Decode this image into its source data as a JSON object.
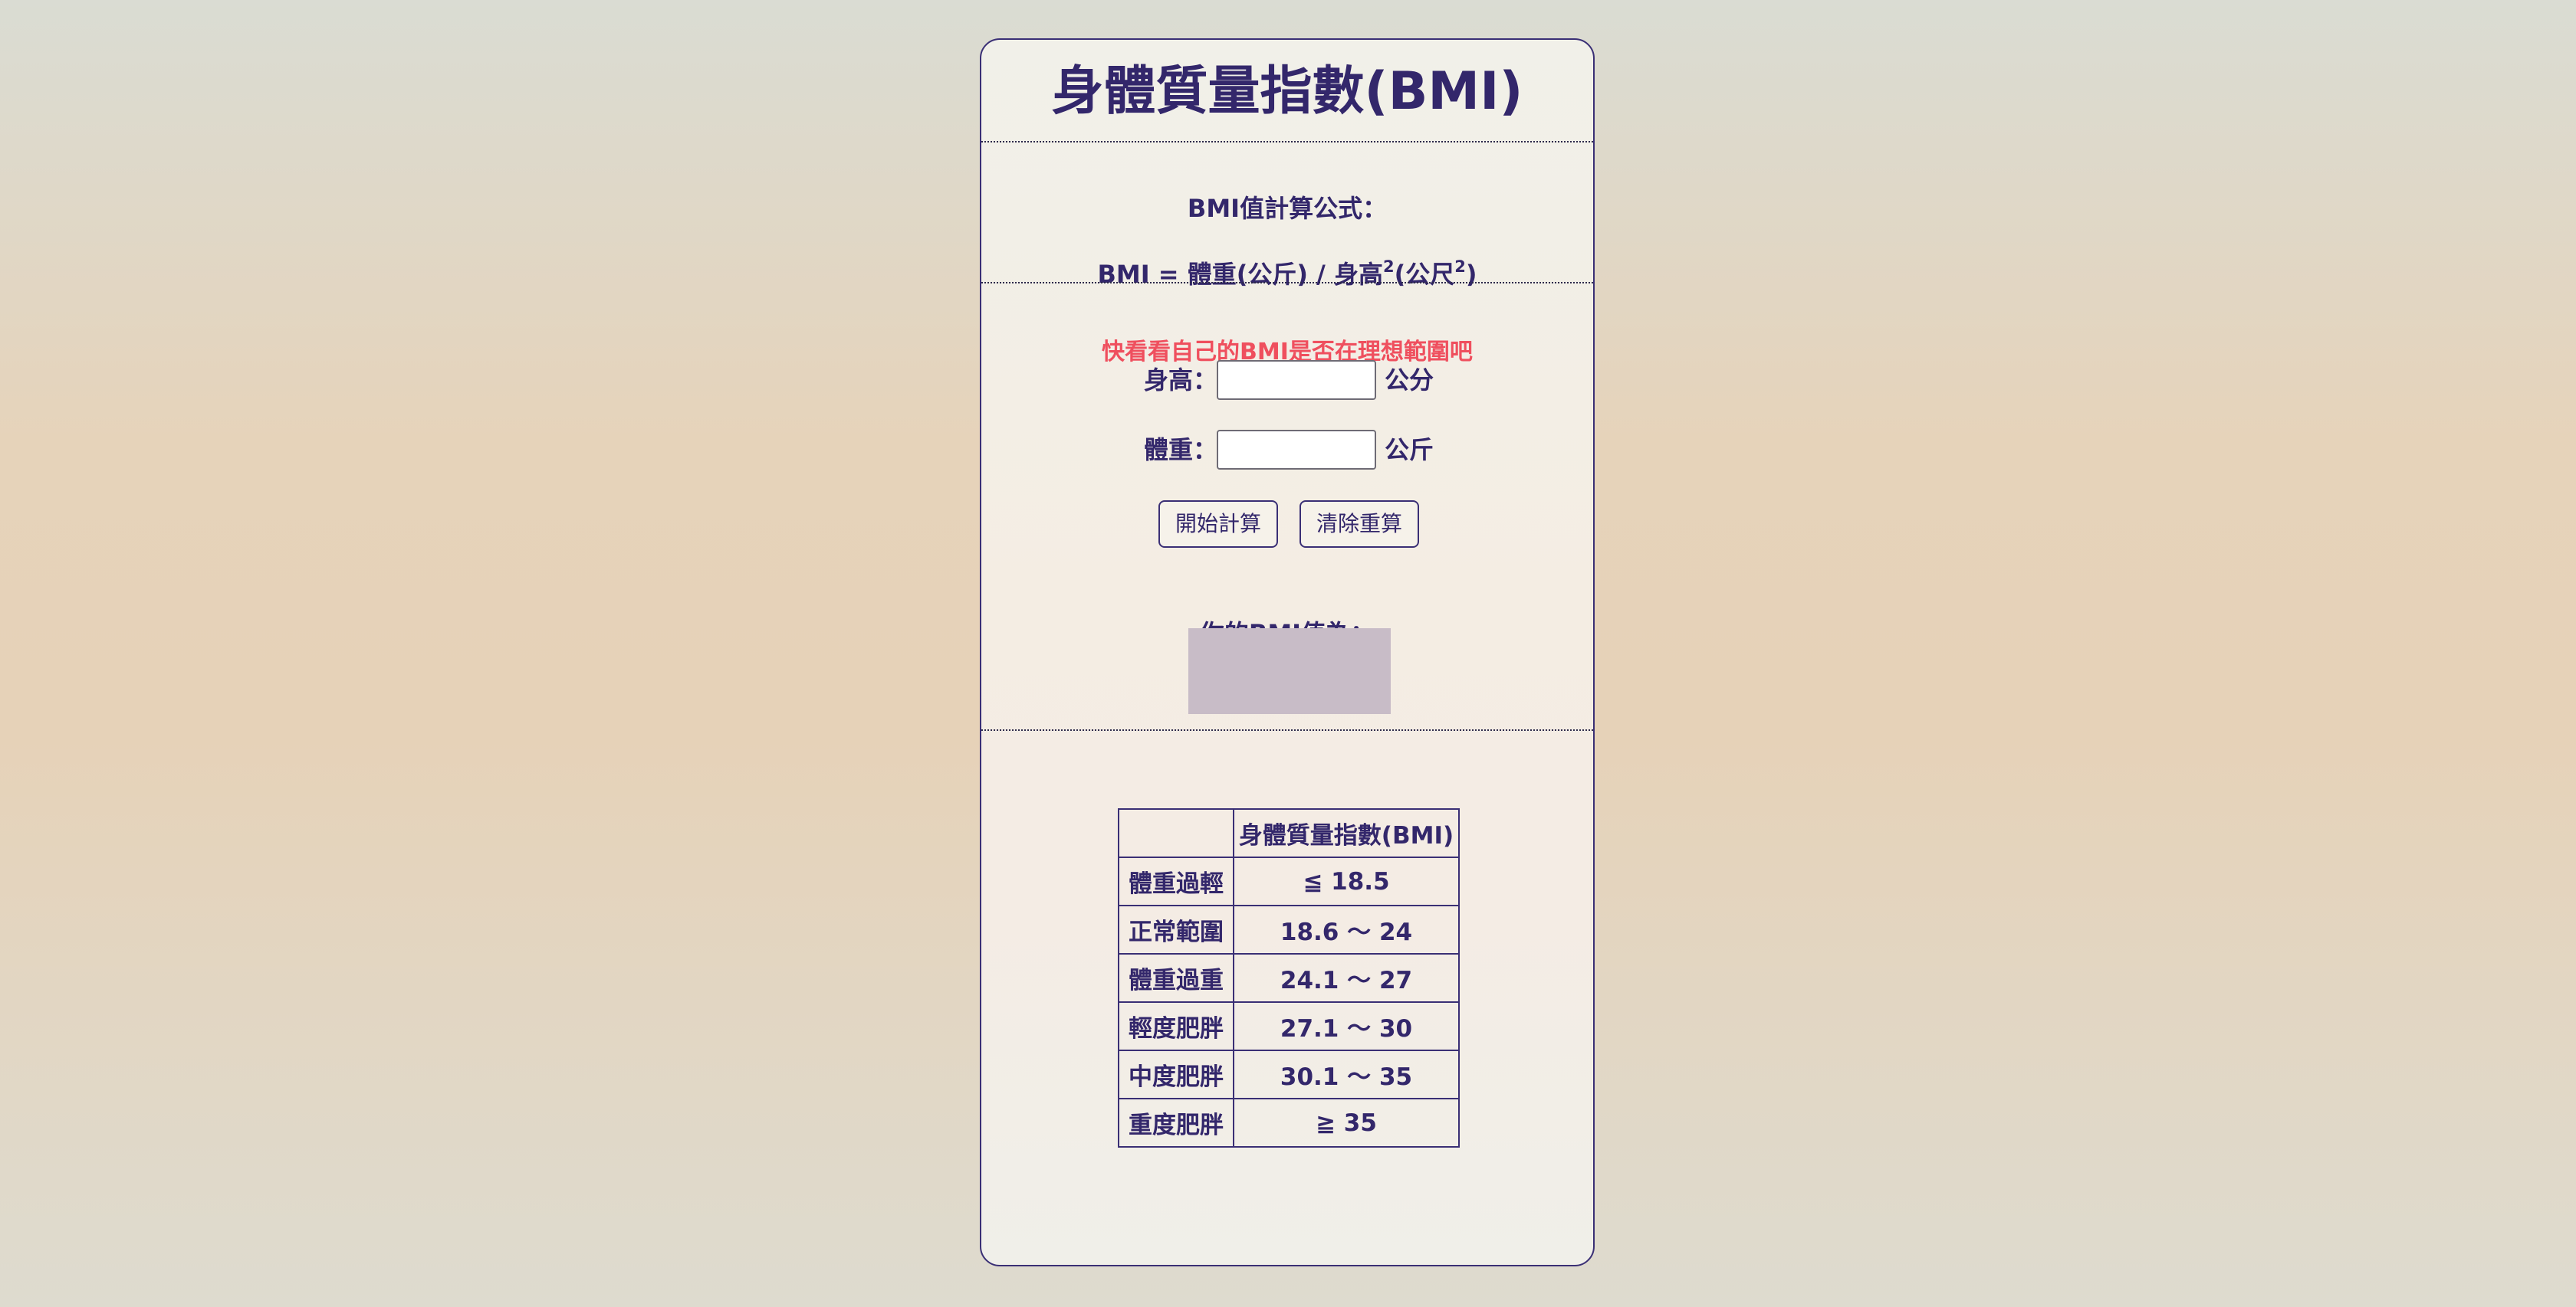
{
  "header": {
    "title": "身體質量指數(BMI)"
  },
  "formula": {
    "label": "BMI值計算公式：",
    "prefix": "BMI = 體重(公斤) / 身高",
    "exp1": "2",
    "middle": "(公尺",
    "exp2": "2",
    "suffix": ")"
  },
  "form": {
    "hint": "快看看自己的BMI是否在理想範圍吧",
    "height_label": "身高：",
    "height_value": "",
    "height_unit": "公分",
    "weight_label": "體重：",
    "weight_value": "",
    "weight_unit": "公斤",
    "calculate_label": "開始計算",
    "reset_label": "清除重算",
    "result_label": "你的BMI值為：",
    "result_value": ""
  },
  "table": {
    "header": [
      "",
      "身體質量指數(BMI)"
    ],
    "rows": [
      [
        "體重過輕",
        "≦ 18.5"
      ],
      [
        "正常範圍",
        "18.6 ～ 24"
      ],
      [
        "體重過重",
        "24.1 ～ 27"
      ],
      [
        "輕度肥胖",
        "27.1 ～ 30"
      ],
      [
        "中度肥胖",
        "30.1 ～ 35"
      ],
      [
        "重度肥胖",
        "≧ 35"
      ]
    ]
  },
  "colors": {
    "text": "#33276b",
    "hint": "#ef4f5e",
    "result_box": "#c8bcc7",
    "border": "#3a2f75"
  }
}
